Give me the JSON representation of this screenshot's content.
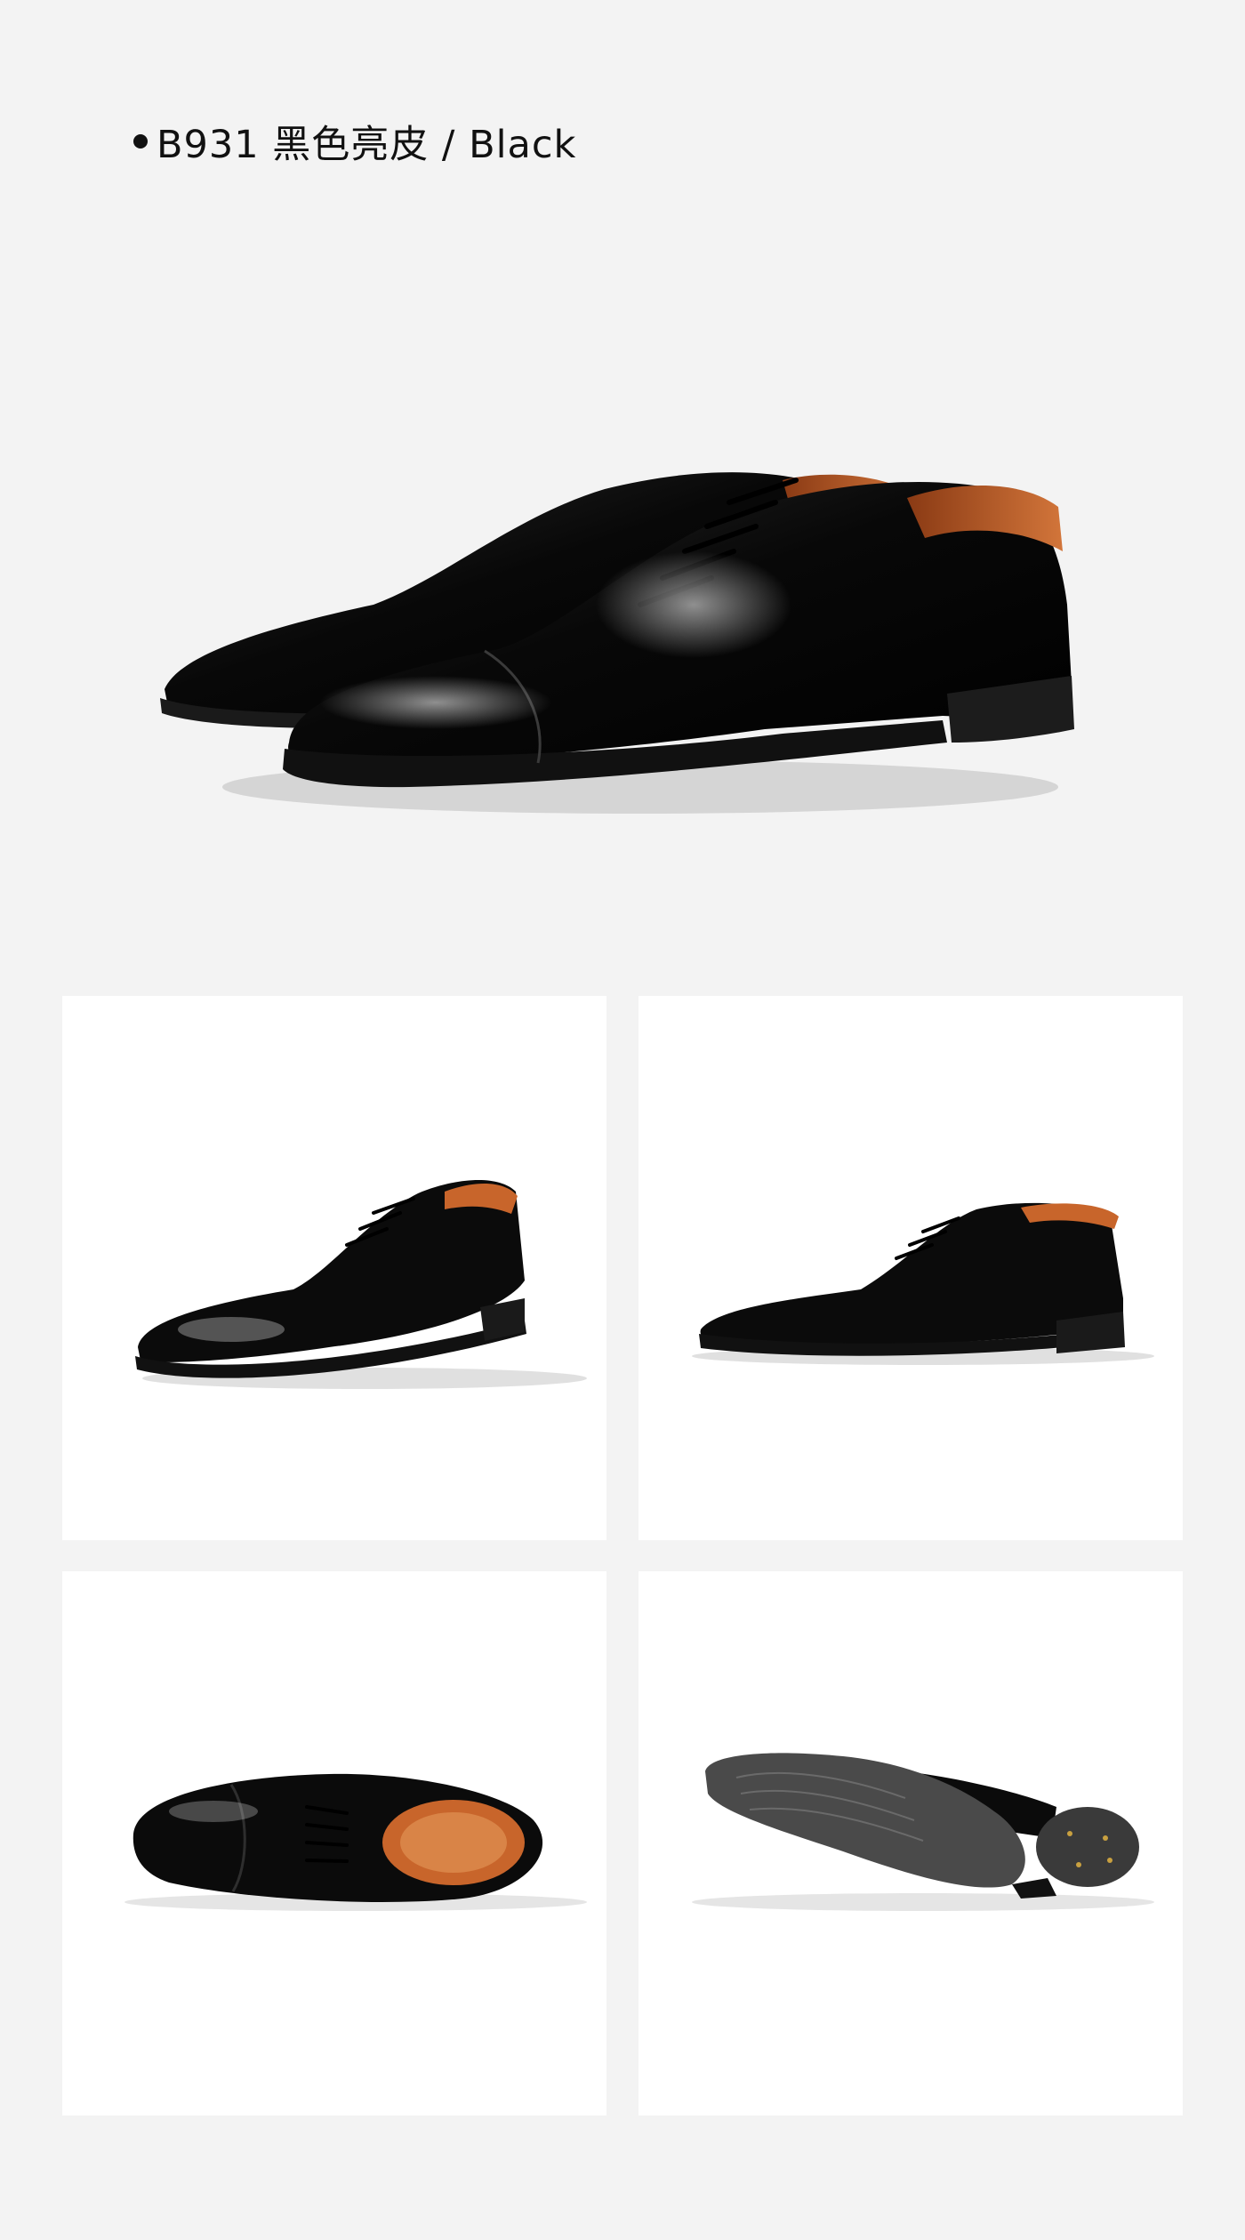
{
  "header": {
    "title": "B931 黑色亮皮 / Black"
  },
  "hero": {
    "image": "black-oxford-shoe-pair-photo"
  },
  "gallery": [
    {
      "image": "shoe-three-quarter-view"
    },
    {
      "image": "shoe-side-view"
    },
    {
      "image": "shoe-top-view"
    },
    {
      "image": "shoe-sole-view"
    }
  ],
  "colors": {
    "page_background": "#f3f3f3",
    "card_background": "#ffffff",
    "leather": "#0b0b0b",
    "lining": "#c8652b"
  }
}
